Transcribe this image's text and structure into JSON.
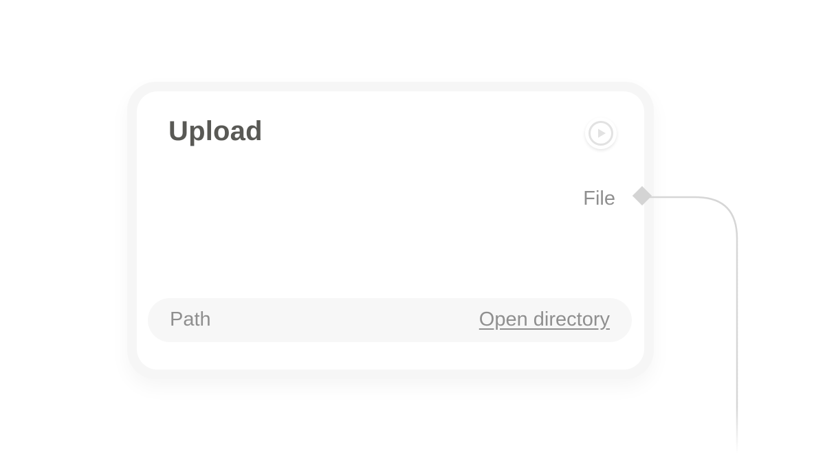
{
  "node": {
    "title": "Upload",
    "run_icon": "play-circle-icon",
    "output_label": "File",
    "path_label": "Path",
    "open_directory_label": "Open directory"
  },
  "colors": {
    "title": "#595955",
    "muted_text": "#8f8f8f",
    "handle": "#d4d4d4",
    "edge": "#d6d6d6",
    "card_border": "#f6f6f6"
  }
}
